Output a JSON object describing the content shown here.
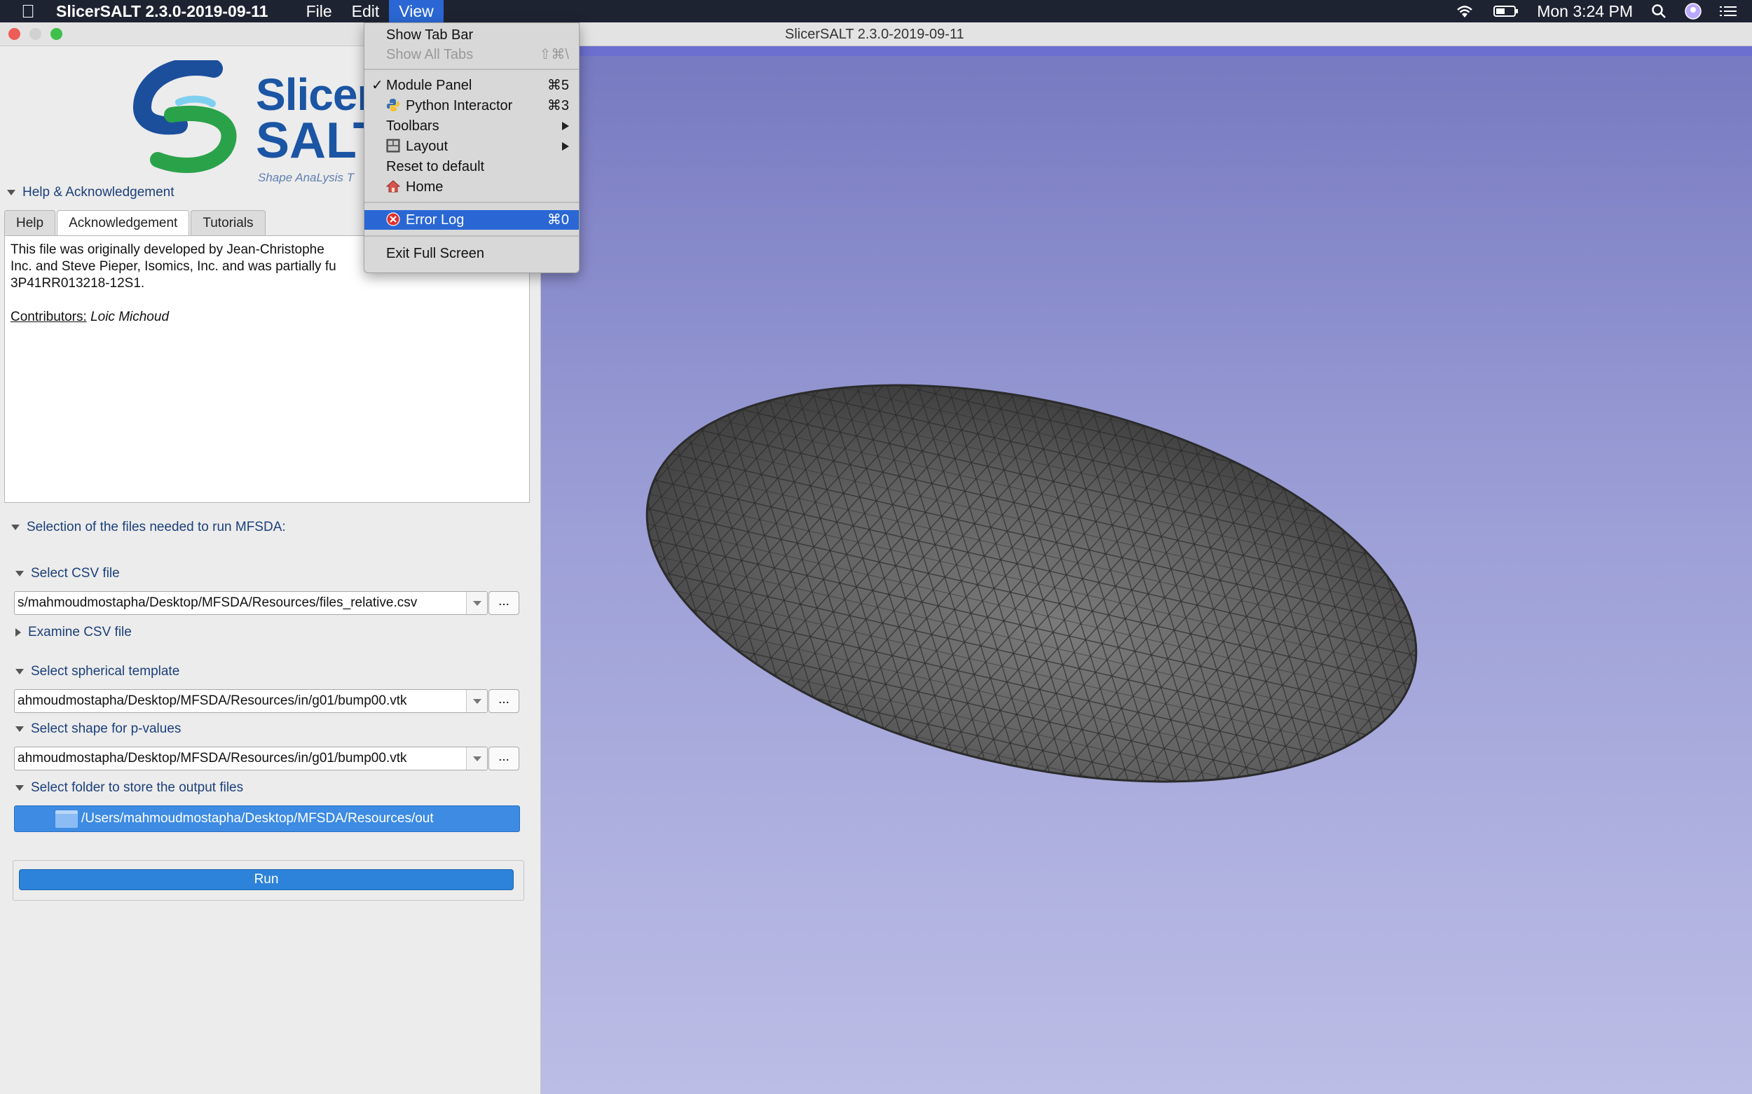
{
  "menubar": {
    "app_name": "SlicerSALT 2.3.0-2019-09-11",
    "menus": [
      "File",
      "Edit",
      "View"
    ],
    "clock": "Mon 3:24 PM"
  },
  "window": {
    "title": "SlicerSALT 2.3.0-2019-09-11"
  },
  "view_menu": {
    "items": [
      {
        "label": "Show Tab Bar"
      },
      {
        "label": "Show All Tabs",
        "shortcut": "⇧⌘\\"
      },
      {
        "label": "Module Panel",
        "shortcut": "⌘5",
        "checked": "✓"
      },
      {
        "label": "Python Interactor",
        "shortcut": "⌘3"
      },
      {
        "label": "Toolbars"
      },
      {
        "label": "Layout"
      },
      {
        "label": "Reset to default"
      },
      {
        "label": "Home"
      },
      {
        "label": "Error Log",
        "shortcut": "⌘0"
      },
      {
        "label": "Exit Full Screen"
      }
    ]
  },
  "logo": {
    "word1": "Slicer",
    "word2": "SALT",
    "tagline": "Shape AnaLysis T"
  },
  "help_section": {
    "header": "Help & Acknowledgement",
    "tabs": [
      "Help",
      "Acknowledgement",
      "Tutorials"
    ],
    "lines": [
      "This file was originally developed by Jean-Christophe",
      "Inc. and Steve Pieper, Isomics, Inc. and was partially fu",
      "3P41RR013218-12S1."
    ],
    "contributors_label": "Contributors:",
    "contributors_name": "Loic Michoud"
  },
  "mfsda": {
    "header": "Selection of the files needed to run MFSDA:",
    "csv_label": "Select CSV file",
    "csv_value": "s/mahmoudmostapha/Desktop/MFSDA/Resources/files_relative.csv",
    "examine_label": "Examine CSV file",
    "template_label": "Select spherical template",
    "template_value": "ahmoudmostapha/Desktop/MFSDA/Resources/in/g01/bump00.vtk",
    "pvalues_label": "Select shape for p-values",
    "pvalues_value": "ahmoudmostapha/Desktop/MFSDA/Resources/in/g01/bump00.vtk",
    "output_label": "Select folder to store the output files",
    "output_value": "/Users/mahmoudmostapha/Desktop/MFSDA/Resources/out",
    "browse_label": "...",
    "run_label": "Run"
  },
  "colors": {
    "menubar_bg": "#1e2332",
    "highlight": "#2a67d4",
    "view_bg_top": "#7779c1",
    "view_bg_bottom": "#bcbde6",
    "mesh_fill": "#5c5c5c",
    "run_button": "#2d82d9"
  }
}
